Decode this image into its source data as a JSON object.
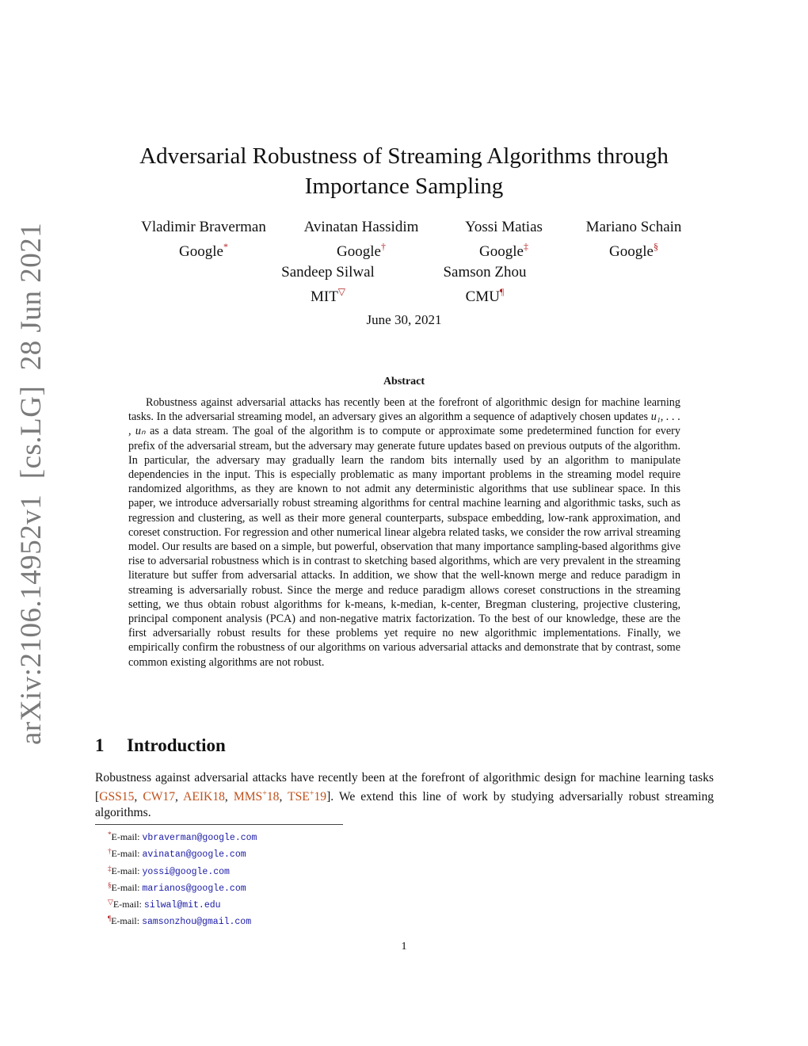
{
  "arxiv_stamp": "arXiv:2106.14952v1  [cs.LG]  28 Jun 2021",
  "title_line1": "Adversarial Robustness of Streaming Algorithms through",
  "title_line2": "Importance Sampling",
  "authors": [
    {
      "name": "Vladimir Braverman",
      "affiliation": "Google",
      "mark": "*"
    },
    {
      "name": "Avinatan Hassidim",
      "affiliation": "Google",
      "mark": "†"
    },
    {
      "name": "Yossi Matias",
      "affiliation": "Google",
      "mark": "‡"
    },
    {
      "name": "Mariano Schain",
      "affiliation": "Google",
      "mark": "§"
    },
    {
      "name": "Sandeep Silwal",
      "affiliation": "MIT",
      "mark": "▽"
    },
    {
      "name": "Samson Zhou",
      "affiliation": "CMU",
      "mark": "¶"
    }
  ],
  "date": "June 30, 2021",
  "abstract": {
    "heading": "Abstract",
    "part1": "Robustness against adversarial attacks has recently been at the forefront of algorithmic design for machine learning tasks. In the adversarial streaming model, an adversary gives an algorithm a sequence of adaptively chosen updates ",
    "math": "u₁, . . . , uₙ",
    "part2": " as a data stream. The goal of the algorithm is to compute or approximate some predetermined function for every prefix of the adversarial stream, but the adversary may generate future updates based on previous outputs of the algorithm. In particular, the adversary may gradually learn the random bits internally used by an algorithm to manipulate dependencies in the input. This is especially problematic as many important problems in the streaming model require randomized algorithms, as they are known to not admit any deterministic algorithms that use sublinear space. In this paper, we introduce adversarially robust streaming algorithms for central machine learning and algorithmic tasks, such as regression and clustering, as well as their more general counterparts, subspace embedding, low-rank approximation, and coreset construction. For regression and other numerical linear algebra related tasks, we consider the row arrival streaming model. Our results are based on a simple, but powerful, observation that many importance sampling-based algorithms give rise to adversarial robustness which is in contrast to sketching based algorithms, which are very prevalent in the streaming literature but suffer from adversarial attacks. In addition, we show that the well-known merge and reduce paradigm in streaming is adversarially robust. Since the merge and reduce paradigm allows coreset constructions in the streaming setting, we thus obtain robust algorithms for k-means, k-median, k-center, Bregman clustering, projective clustering, principal component analysis (PCA) and non-negative matrix factorization. To the best of our knowledge, these are the first adversarially robust results for these problems yet require no new algorithmic implementations. Finally, we empirically confirm the robustness of our algorithms on various adversarial attacks and demonstrate that by contrast, some common existing algorithms are not robust."
  },
  "section": {
    "number": "1",
    "title": "Introduction",
    "text_before": "Robustness against adversarial attacks have recently been at the forefront of algorithmic design for machine learning tasks [",
    "citations": [
      {
        "label": "GSS15",
        "sup": ""
      },
      {
        "label": "CW17",
        "sup": ""
      },
      {
        "label": "AEIK18",
        "sup": ""
      },
      {
        "label": "MMS",
        "sup": "+",
        "suffix": "18"
      },
      {
        "label": "TSE",
        "sup": "+",
        "suffix": "19"
      }
    ],
    "text_after": "]. We extend this line of work by studying adversarially robust streaming algorithms."
  },
  "footnotes": [
    {
      "mark": "*",
      "label": "E-mail: ",
      "email": "vbraverman@google.com"
    },
    {
      "mark": "†",
      "label": "E-mail: ",
      "email": "avinatan@google.com"
    },
    {
      "mark": "‡",
      "label": "E-mail: ",
      "email": "yossi@google.com"
    },
    {
      "mark": "§",
      "label": "E-mail: ",
      "email": "marianos@google.com"
    },
    {
      "mark": "▽",
      "label": "E-mail: ",
      "email": "silwal@mit.edu"
    },
    {
      "mark": "¶",
      "label": "E-mail: ",
      "email": "samsonzhou@gmail.com"
    }
  ],
  "page_number": "1"
}
